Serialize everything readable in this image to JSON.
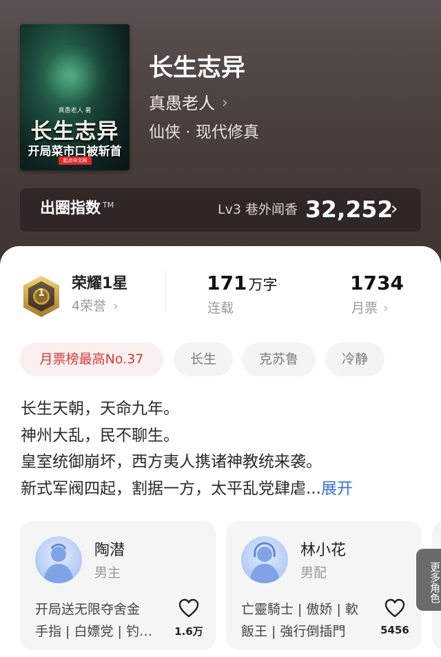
{
  "book": {
    "cover_author_small": "真愚老人 著",
    "cover_title": "长生志异",
    "cover_subtitle": "开局菜市口被斩首",
    "cover_publisher": "起点中文网",
    "title": "长生志异",
    "author": "真愚老人",
    "genre": "仙侠 · 现代修真"
  },
  "ranking": {
    "label": "出圈指数",
    "trademark": "TM",
    "level": "Lv3 巷外闻香",
    "score": "32,252"
  },
  "stats": {
    "honor_title": "荣耀1星",
    "honor_sub": "4荣誉",
    "honor_badge_number": "1",
    "words_value": "171",
    "words_unit": "万字",
    "words_status": "连载",
    "monthly_votes": "1734",
    "monthly_votes_label": "月票"
  },
  "tags": [
    "月票榜最高No.37",
    "长生",
    "克苏鲁",
    "冷静"
  ],
  "description": {
    "lines": [
      "长生天朝，天命九年。",
      "神州大乱，民不聊生。",
      "皇室统御崩坏，西方夷人携诸神教统来袭。",
      "新式军阀四起，割据一方，太平乱党肆虐..."
    ],
    "expand_label": "展开"
  },
  "characters": [
    {
      "name": "陶潜",
      "role": "男主",
      "traits_line1": "开局送无限夺舍金",
      "traits_line2": "手指 | 白嫖党 | 钓…",
      "likes": "1.6万"
    },
    {
      "name": "林小花",
      "role": "男配",
      "traits_line1": "亡靈騎士 | 傲娇 | 軟",
      "traits_line2": "飯王 | 強行倒插門",
      "likes": "5456"
    }
  ],
  "more_roles_label": "更多角色",
  "colors": {
    "accent_blue": "#3a6fd8",
    "tag_red": "#d33a3a",
    "badge_gold": "#c9a14a"
  }
}
